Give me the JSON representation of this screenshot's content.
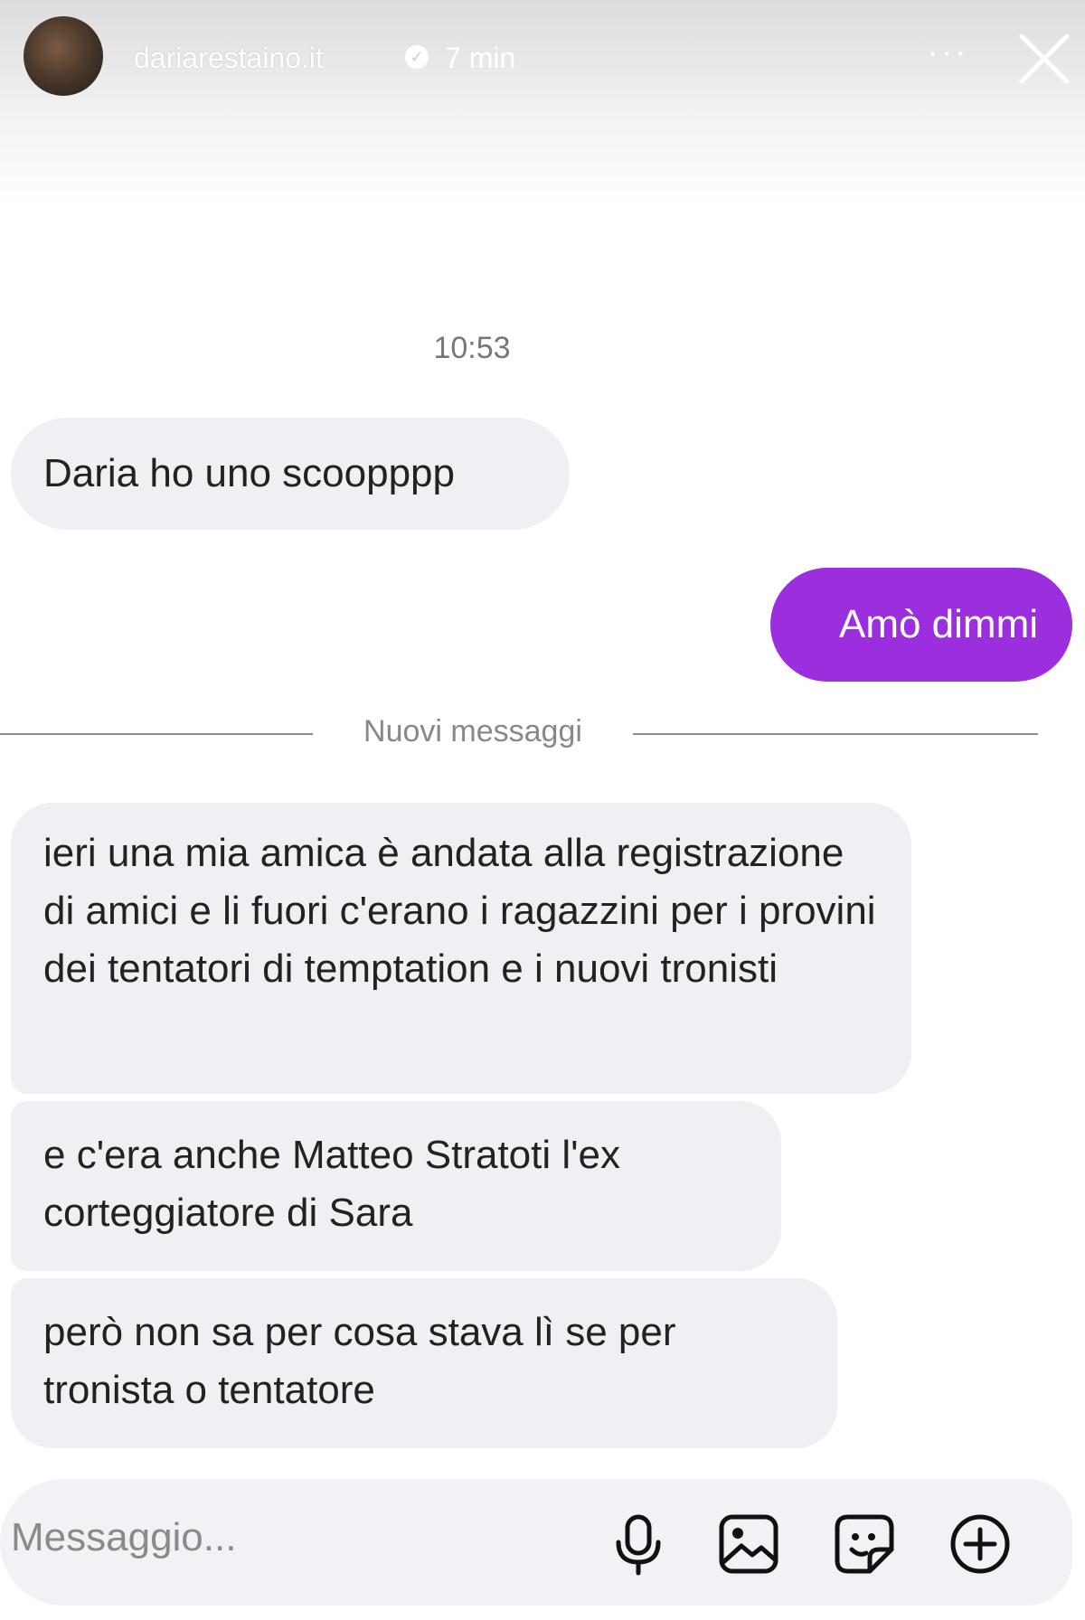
{
  "header": {
    "username": "dariarestaino.it",
    "verified_icon": "verified-badge-icon",
    "time_ago": "7 min",
    "more_icon": "more-options-icon",
    "close_icon": "close-icon",
    "more_symbol": "···",
    "verified_symbol": "✓"
  },
  "conversation": {
    "timestamp": "10:53",
    "messages": [
      {
        "direction": "incoming",
        "text": "Daria ho uno scoopppp"
      },
      {
        "direction": "outgoing",
        "text": "Amò dimmi"
      }
    ],
    "new_messages_divider": "Nuovi messaggi",
    "new_messages": [
      {
        "direction": "incoming",
        "text": "ieri una mia amica è andata alla registrazione di amici e li fuori c'erano i ragazzini per i provini dei tentatori di temptation e i nuovi tronisti"
      },
      {
        "direction": "incoming",
        "text": "e c'era anche Matteo Stratoti l'ex corteggiatore di Sara"
      },
      {
        "direction": "incoming",
        "text": "però non sa per cosa stava lì se per tronista o tentatore"
      }
    ]
  },
  "composer": {
    "placeholder": "Messaggio...",
    "icons": [
      "microphone-icon",
      "image-icon",
      "sticker-icon",
      "add-icon"
    ]
  },
  "colors": {
    "outgoing_bubble": "#9b2fde",
    "incoming_bubble": "#eff0f3",
    "text": "#222222"
  }
}
